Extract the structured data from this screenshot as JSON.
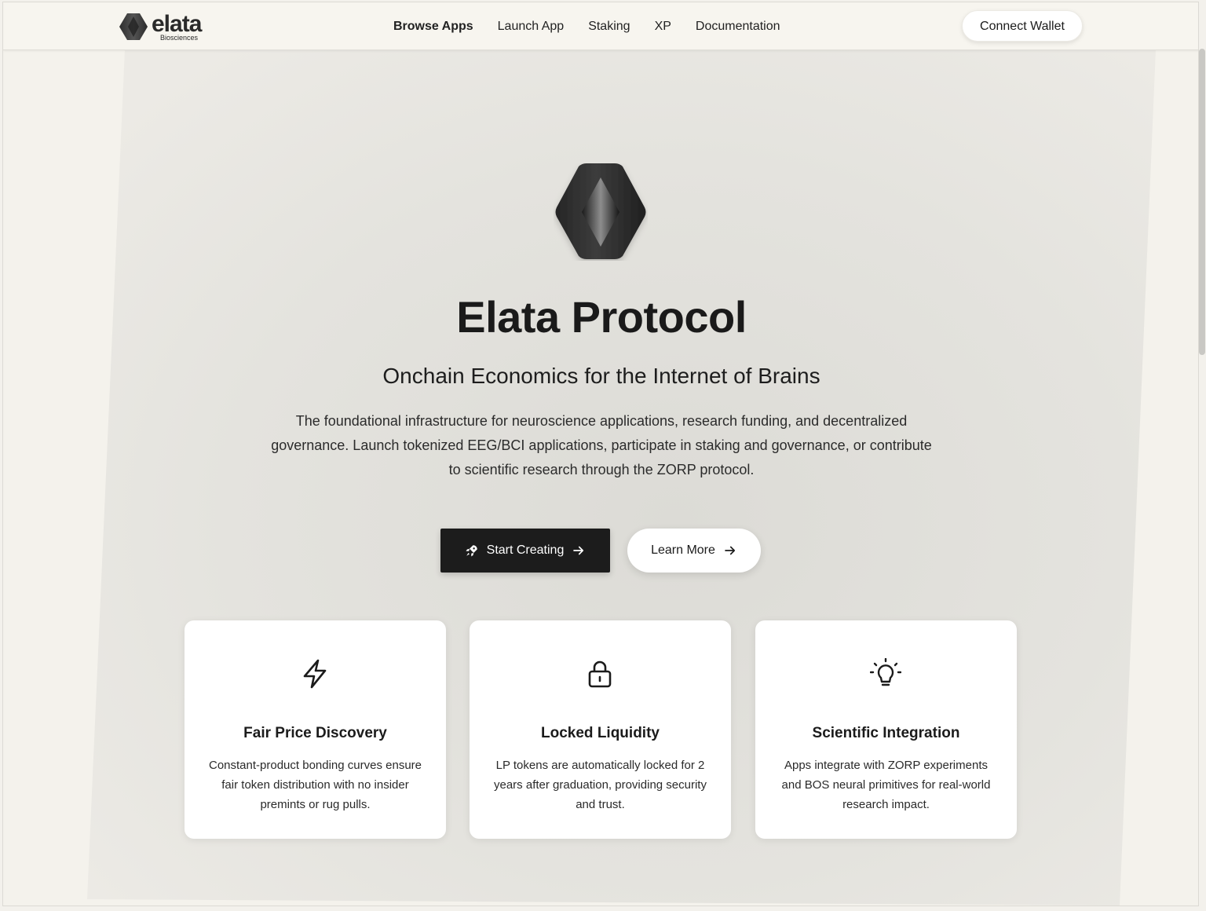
{
  "brand": {
    "wordmark": "elata",
    "sub": "Biosciences"
  },
  "nav": {
    "items": [
      {
        "label": "Browse Apps",
        "active": true
      },
      {
        "label": "Launch App",
        "active": false
      },
      {
        "label": "Staking",
        "active": false
      },
      {
        "label": "XP",
        "active": false
      },
      {
        "label": "Documentation",
        "active": false
      }
    ],
    "connect_wallet": "Connect Wallet"
  },
  "hero": {
    "title": "Elata Protocol",
    "subtitle": "Onchain Economics for the Internet of Brains",
    "description": "The foundational infrastructure for neuroscience applications, research funding, and decentralized governance. Launch tokenized EEG/BCI applications, participate in staking and governance, or contribute to scientific research through the ZORP protocol.",
    "primary_button": {
      "label": "Start Creating",
      "icon": "rocket-icon",
      "trailing_icon": "arrow-right-icon"
    },
    "secondary_button": {
      "label": "Learn More",
      "trailing_icon": "arrow-right-icon"
    }
  },
  "features": [
    {
      "icon": "lightning-icon",
      "title": "Fair Price Discovery",
      "text": "Constant-product bonding curves ensure fair token distribution with no insider premints or rug pulls."
    },
    {
      "icon": "lock-icon",
      "title": "Locked Liquidity",
      "text": "LP tokens are automatically locked for 2 years after graduation, providing security and trust."
    },
    {
      "icon": "lightbulb-icon",
      "title": "Scientific Integration",
      "text": "Apps integrate with ZORP experiments and BOS neural primitives for real-world research impact."
    }
  ],
  "colors": {
    "page_bg": "#f4f2ec",
    "dark": "#1c1c1c",
    "card_bg": "#ffffff"
  }
}
